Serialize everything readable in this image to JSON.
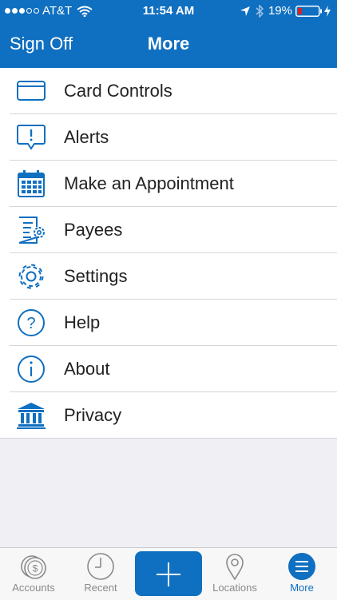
{
  "status_bar": {
    "carrier": "AT&T",
    "time": "11:54 AM",
    "battery": "19%",
    "signal_bars_filled": 3,
    "signal_bars_total": 5,
    "battery_level": 0.19,
    "icons": [
      "wifi-icon",
      "location-arrow-icon",
      "bluetooth-icon",
      "battery-icon",
      "charging-bolt-icon"
    ]
  },
  "nav": {
    "left_button": "Sign Off",
    "title": "More"
  },
  "menu": {
    "items": [
      {
        "label": "Card Controls",
        "icon": "card-icon"
      },
      {
        "label": "Alerts",
        "icon": "alert-bubble-icon"
      },
      {
        "label": "Make an Appointment",
        "icon": "calendar-icon"
      },
      {
        "label": "Payees",
        "icon": "payees-document-icon"
      },
      {
        "label": "Settings",
        "icon": "gear-icon"
      },
      {
        "label": "Help",
        "icon": "question-icon"
      },
      {
        "label": "About",
        "icon": "info-icon"
      },
      {
        "label": "Privacy",
        "icon": "bank-icon"
      }
    ]
  },
  "tab_bar": {
    "tabs": [
      {
        "label": "Accounts",
        "icon": "dollar-coin-icon"
      },
      {
        "label": "Recent",
        "icon": "clock-icon"
      },
      {
        "label": "",
        "icon": "plus-icon"
      },
      {
        "label": "Locations",
        "icon": "map-pin-icon"
      },
      {
        "label": "More",
        "icon": "hamburger-menu-icon",
        "active": true
      }
    ]
  },
  "colors": {
    "brand_blue": "#0f6fc0",
    "background": "#efeff4",
    "tab_inactive": "#8a8a8e",
    "battery_low": "#e0201f"
  }
}
